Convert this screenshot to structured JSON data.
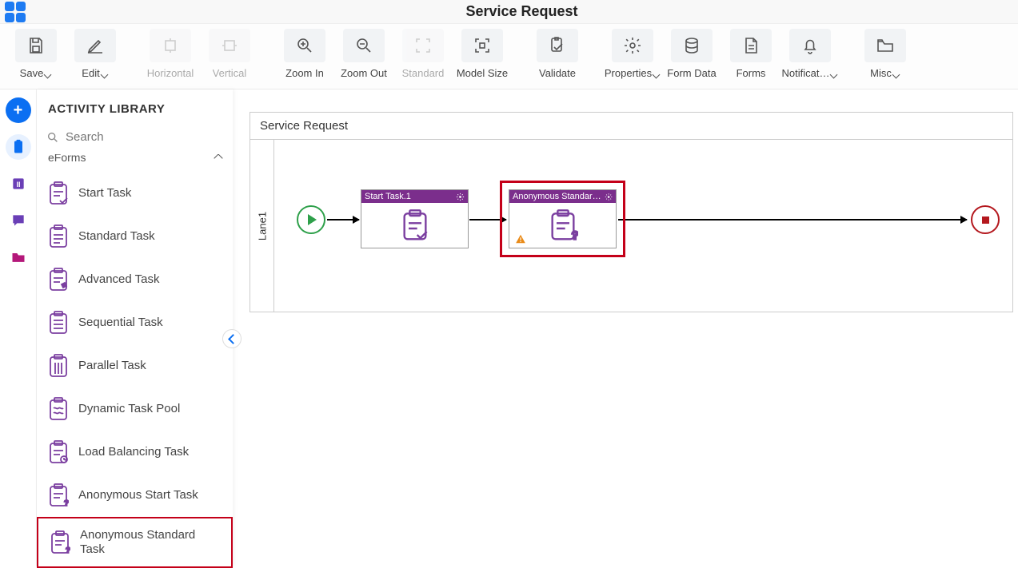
{
  "header": {
    "title": "Service Request"
  },
  "toolbar": {
    "save": "Save",
    "edit": "Edit",
    "horizontal": "Horizontal",
    "vertical": "Vertical",
    "zoom_in": "Zoom In",
    "zoom_out": "Zoom Out",
    "standard": "Standard",
    "model_size": "Model Size",
    "validate": "Validate",
    "properties": "Properties",
    "form_data": "Form Data",
    "forms": "Forms",
    "notifications": "Notificat…",
    "misc": "Misc"
  },
  "alib": {
    "title": "ACTIVITY LIBRARY",
    "search_placeholder": "Search",
    "group_cut": "eForms",
    "items": {
      "start_task": "Start Task",
      "standard_task": "Standard Task",
      "advanced_task": "Advanced Task",
      "sequential_task": "Sequential Task",
      "parallel_task": "Parallel Task",
      "dynamic_task_pool": "Dynamic Task Pool",
      "load_balancing_task": "Load Balancing Task",
      "anonymous_start_task": "Anonymous Start Task",
      "anonymous_standard_task": "Anonymous Standard Task"
    }
  },
  "canvas": {
    "title": "Service Request",
    "lane1": "Lane1",
    "node1": "Start Task.1",
    "node2": "Anonymous Standard T..."
  }
}
